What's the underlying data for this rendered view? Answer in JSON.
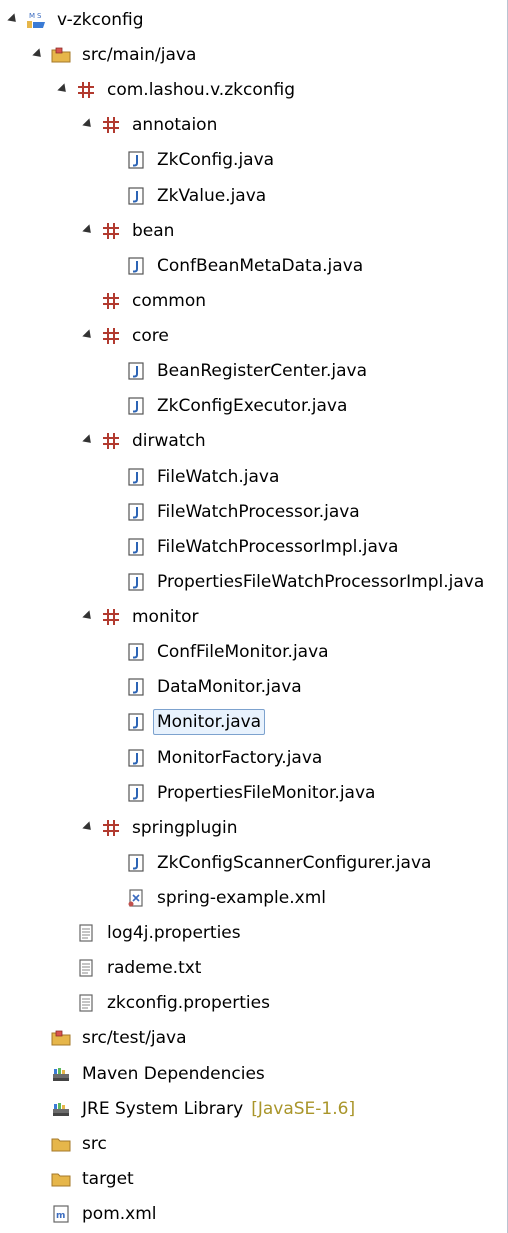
{
  "tree": [
    {
      "label": "v-zkconfig",
      "icon": "maven-project-icon",
      "depth": 0,
      "state": "expanded"
    },
    {
      "label": "src/main/java",
      "icon": "source-folder-icon",
      "depth": 1,
      "state": "expanded"
    },
    {
      "label": "com.lashou.v.zkconfig",
      "icon": "package-icon",
      "depth": 2,
      "state": "expanded"
    },
    {
      "label": "annotaion",
      "icon": "package-icon",
      "depth": 3,
      "state": "expanded"
    },
    {
      "label": "ZkConfig.java",
      "icon": "java-file-icon",
      "depth": 4,
      "state": "collapsed"
    },
    {
      "label": "ZkValue.java",
      "icon": "java-file-icon",
      "depth": 4,
      "state": "collapsed"
    },
    {
      "label": "bean",
      "icon": "package-icon",
      "depth": 3,
      "state": "expanded"
    },
    {
      "label": "ConfBeanMetaData.java",
      "icon": "java-file-icon",
      "depth": 4,
      "state": "collapsed"
    },
    {
      "label": "common",
      "icon": "package-icon",
      "depth": 3,
      "state": "collapsed"
    },
    {
      "label": "core",
      "icon": "package-icon",
      "depth": 3,
      "state": "expanded"
    },
    {
      "label": "BeanRegisterCenter.java",
      "icon": "java-file-icon",
      "depth": 4,
      "state": "collapsed"
    },
    {
      "label": "ZkConfigExecutor.java",
      "icon": "java-file-icon",
      "depth": 4,
      "state": "collapsed"
    },
    {
      "label": "dirwatch",
      "icon": "package-icon",
      "depth": 3,
      "state": "expanded"
    },
    {
      "label": "FileWatch.java",
      "icon": "java-file-icon",
      "depth": 4,
      "state": "collapsed"
    },
    {
      "label": "FileWatchProcessor.java",
      "icon": "java-file-icon",
      "depth": 4,
      "state": "collapsed"
    },
    {
      "label": "FileWatchProcessorImpl.java",
      "icon": "java-file-icon",
      "depth": 4,
      "state": "collapsed"
    },
    {
      "label": "PropertiesFileWatchProcessorImpl.java",
      "icon": "java-file-icon",
      "depth": 4,
      "state": "collapsed"
    },
    {
      "label": "monitor",
      "icon": "package-icon",
      "depth": 3,
      "state": "expanded"
    },
    {
      "label": "ConfFileMonitor.java",
      "icon": "java-file-icon",
      "depth": 4,
      "state": "collapsed"
    },
    {
      "label": "DataMonitor.java",
      "icon": "java-file-icon",
      "depth": 4,
      "state": "collapsed"
    },
    {
      "label": "Monitor.java",
      "icon": "java-file-icon",
      "depth": 4,
      "state": "collapsed",
      "selected": true
    },
    {
      "label": "MonitorFactory.java",
      "icon": "java-file-icon",
      "depth": 4,
      "state": "collapsed"
    },
    {
      "label": "PropertiesFileMonitor.java",
      "icon": "java-file-icon",
      "depth": 4,
      "state": "collapsed"
    },
    {
      "label": "springplugin",
      "icon": "package-icon",
      "depth": 3,
      "state": "expanded"
    },
    {
      "label": "ZkConfigScannerConfigurer.java",
      "icon": "java-file-icon",
      "depth": 4,
      "state": "collapsed"
    },
    {
      "label": "spring-example.xml",
      "icon": "xml-file-icon",
      "depth": 4,
      "state": "none"
    },
    {
      "label": "log4j.properties",
      "icon": "text-file-icon",
      "depth": 2,
      "state": "none"
    },
    {
      "label": "rademe.txt",
      "icon": "text-file-icon",
      "depth": 2,
      "state": "none"
    },
    {
      "label": "zkconfig.properties",
      "icon": "text-file-icon",
      "depth": 2,
      "state": "none"
    },
    {
      "label": "src/test/java",
      "icon": "source-folder-icon",
      "depth": 1,
      "state": "collapsed"
    },
    {
      "label": "Maven Dependencies",
      "icon": "library-icon",
      "depth": 1,
      "state": "collapsed"
    },
    {
      "label": "JRE System Library",
      "icon": "library-icon",
      "depth": 1,
      "state": "collapsed",
      "decoration": "[JavaSE-1.6]"
    },
    {
      "label": "src",
      "icon": "folder-icon",
      "depth": 1,
      "state": "collapsed"
    },
    {
      "label": "target",
      "icon": "folder-icon",
      "depth": 1,
      "state": "collapsed"
    },
    {
      "label": "pom.xml",
      "icon": "maven-pom-icon",
      "depth": 1,
      "state": "none"
    }
  ],
  "colors": {
    "package": "#b23a2f",
    "java": "#2c64b5",
    "folder": "#e6b64a",
    "selection_bg": "#e8f2fd",
    "selection_border": "#7da2ce",
    "decoration": "#a9952a"
  }
}
